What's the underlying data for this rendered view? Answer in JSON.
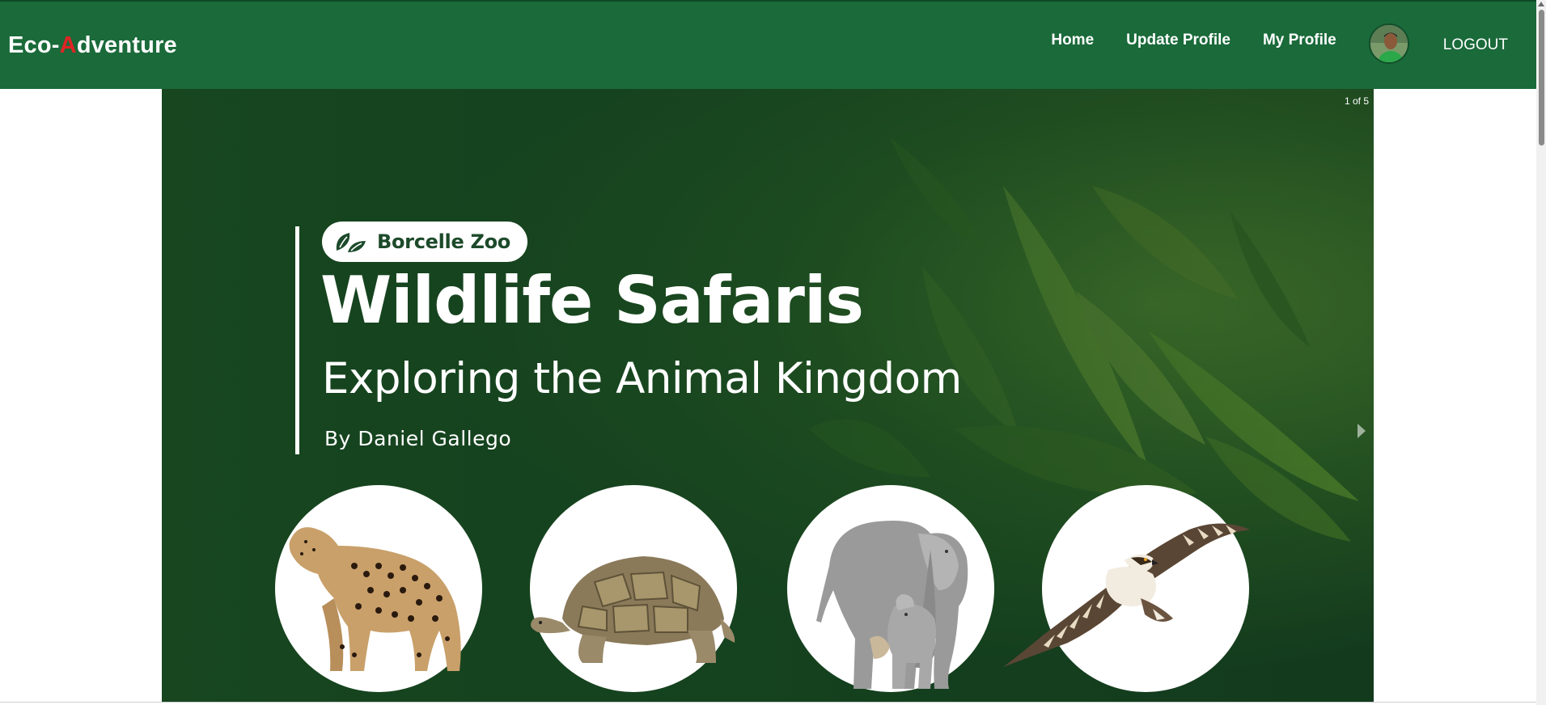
{
  "navbar": {
    "brand_prefix": "Eco-",
    "brand_accent": "A",
    "brand_suffix": "dventure",
    "links": [
      "Home",
      "Update Profile",
      "My Profile"
    ],
    "logout_label": "LOGOUT",
    "avatar_icon": "user-avatar",
    "colors": {
      "background": "#1a6a3a",
      "accent": "#e02424"
    }
  },
  "carousel": {
    "counter": "1 of 5",
    "slide": {
      "badge": "Borcelle Zoo",
      "badge_icon": "leaves-icon",
      "title": "Wildlife Safaris",
      "subtitle": "Exploring the Animal Kingdom",
      "byline": "By Daniel Gallego",
      "animals": [
        "leopard",
        "tortoise",
        "elephant",
        "osprey"
      ]
    },
    "next_icon": "chevron-right-icon"
  }
}
